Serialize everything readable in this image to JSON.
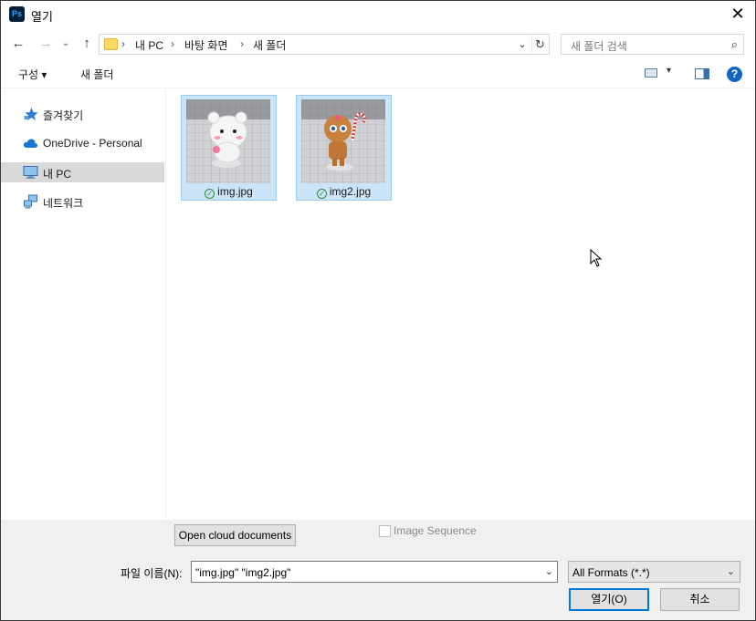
{
  "window": {
    "app_icon_text": "Ps",
    "title": "열기"
  },
  "nav": {
    "breadcrumbs": [
      "내 PC",
      "바탕 화면",
      "새 폴더"
    ],
    "search_placeholder": "새 폴더 검색"
  },
  "toolbar": {
    "organize_label": "구성 ▾",
    "new_folder_label": "새 폴더",
    "help_label": "?"
  },
  "sidebar": {
    "items": [
      {
        "label": "즐겨찾기",
        "icon": "star-icon"
      },
      {
        "label": "OneDrive - Personal",
        "icon": "cloud-icon"
      },
      {
        "label": "내 PC",
        "icon": "computer-icon",
        "selected": true
      },
      {
        "label": "네트워크",
        "icon": "network-icon"
      }
    ]
  },
  "files": [
    {
      "name": "img.jpg",
      "status_icon": "synced-check-icon",
      "selected": true
    },
    {
      "name": "img2.jpg",
      "status_icon": "synced-check-icon",
      "selected": true
    }
  ],
  "bottom": {
    "cloud_button": "Open cloud documents",
    "image_sequence_label": "Image Sequence",
    "filename_label": "파일 이름(N):",
    "filename_value": "\"img.jpg\" \"img2.jpg\"",
    "format_value": "All Formats (*.*)",
    "open_button": "열기(O)",
    "cancel_button": "취소"
  },
  "colors": {
    "selection": "#cce4f7",
    "selection_border": "#99c9ef",
    "sidebar_selected": "#d9d9d9",
    "accent": "#0078d7"
  }
}
